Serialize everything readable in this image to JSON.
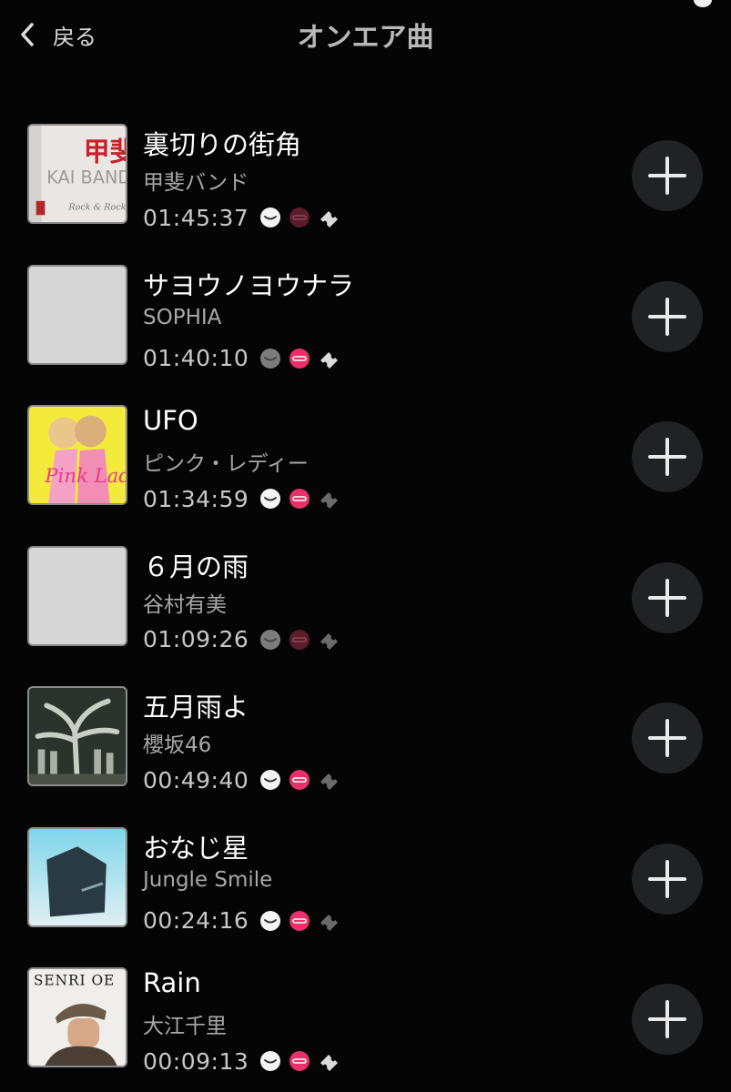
{
  "header": {
    "back_label": "戻る",
    "title": "オンエア曲"
  },
  "songs": [
    {
      "title": "裏切りの街角",
      "artist": "甲斐バンド",
      "time": "01:45:37",
      "icon1": "bright",
      "icon2": "dim",
      "icon3": "bright",
      "art": "kai"
    },
    {
      "title": "サヨウノヨウナラ",
      "artist": "SOPHIA",
      "time": "01:40:10",
      "icon1": "dim",
      "icon2": "bright",
      "icon3": "bright",
      "art": "blank"
    },
    {
      "title": "UFO",
      "artist": "ピンク・レディー",
      "time": "01:34:59",
      "icon1": "bright",
      "icon2": "bright",
      "icon3": "dim",
      "art": "pink"
    },
    {
      "title": "６月の雨",
      "artist": "谷村有美",
      "time": "01:09:26",
      "icon1": "dim",
      "icon2": "dim",
      "icon3": "dim",
      "art": "blank"
    },
    {
      "title": "五月雨よ",
      "artist": "櫻坂46",
      "time": "00:49:40",
      "icon1": "bright",
      "icon2": "bright",
      "icon3": "dim",
      "art": "forest"
    },
    {
      "title": "おなじ星",
      "artist": "Jungle Smile",
      "time": "00:24:16",
      "icon1": "bright",
      "icon2": "bright",
      "icon3": "dim",
      "art": "sky"
    },
    {
      "title": "Rain",
      "artist": "大江千里",
      "time": "00:09:13",
      "icon1": "bright",
      "icon2": "bright",
      "icon3": "bright",
      "art": "senri",
      "art_text": "SENRI OE"
    }
  ],
  "colors": {
    "background": "#050505",
    "add_button": "#202224",
    "pink_icon": "#e8316a",
    "pink_icon_dim": "#5a1d2c"
  },
  "icons": [
    "back-chevron-icon",
    "amazon-icon",
    "recochoku-icon",
    "ticket-icon",
    "plus-icon"
  ]
}
